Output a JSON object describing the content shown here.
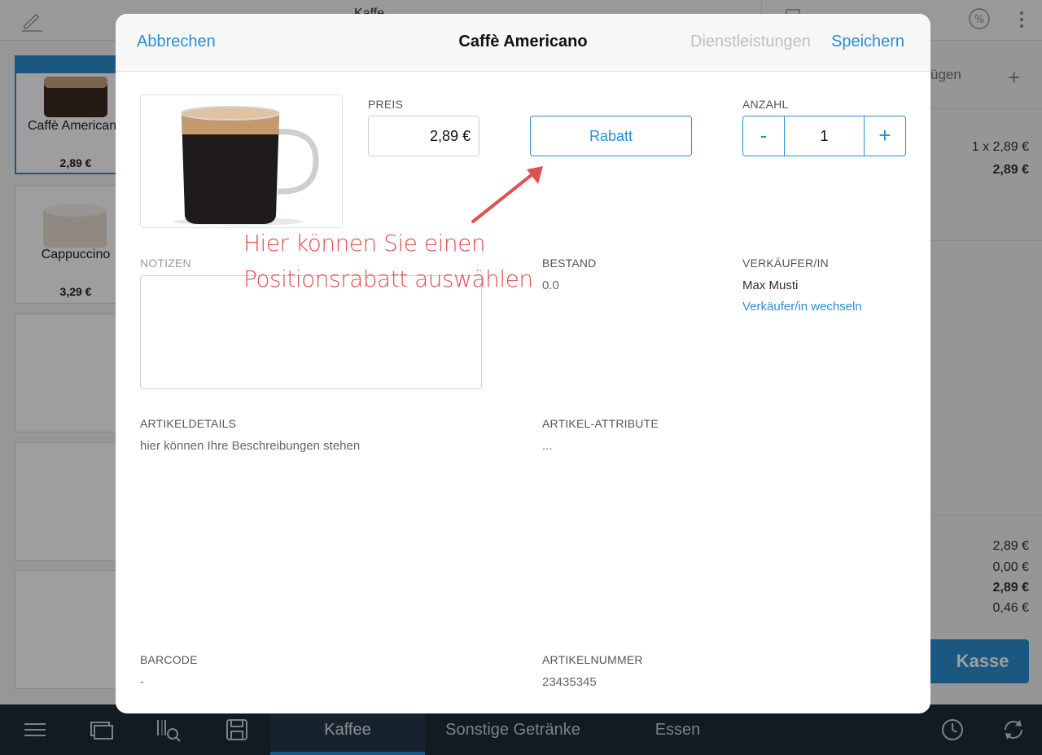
{
  "background": {
    "topbar_title": "Kaffe",
    "tiles": [
      {
        "name": "Caffè Americano",
        "price": "2,89 €"
      },
      {
        "name": "Cappuccino",
        "price": "3,29 €"
      }
    ],
    "right_panel": {
      "add_label": "ügen",
      "line_item_qty": "1 x 2,89 €",
      "line_item_total": "2,89 €",
      "summary": [
        "2,89 €",
        "0,00 €",
        "2,89 €",
        "0,46 €"
      ],
      "checkout_label": "Kasse"
    },
    "bottom_tabs": [
      "Kaffee",
      "Sonstige Getränke",
      "Essen"
    ]
  },
  "modal": {
    "cancel_label": "Abbrechen",
    "title": "Caffè Americano",
    "services_label": "Dienstleistungen",
    "save_label": "Speichern",
    "price_label": "PREIS",
    "price_value": "2,89 €",
    "discount_label": "Rabatt",
    "quantity_label": "ANZAHL",
    "quantity_minus": "-",
    "quantity_value": "1",
    "quantity_plus": "+",
    "notes_label": "NOTIZEN",
    "stock_label": "BESTAND",
    "stock_value": "0.0",
    "seller_label": "VERKÄUFER/IN",
    "seller_value": "Max Musti",
    "seller_change_link": "Verkäufer/in wechseln",
    "details_label": "ARTIKELDETAILS",
    "details_value": "hier können Ihre Beschreibungen stehen",
    "attributes_label": "ARTIKEL-ATTRIBUTE",
    "attributes_value": "...",
    "barcode_label": "BARCODE",
    "barcode_value": "-",
    "article_number_label": "ARTIKELNUMMER",
    "article_number_value": "23435345"
  },
  "annotation": {
    "line1": "Hier können Sie einen",
    "line2": "Positionsrabatt auswählen",
    "color": "#e0504e"
  },
  "colors": {
    "accent": "#2a8fd0",
    "bottombar": "#1e2b38"
  }
}
